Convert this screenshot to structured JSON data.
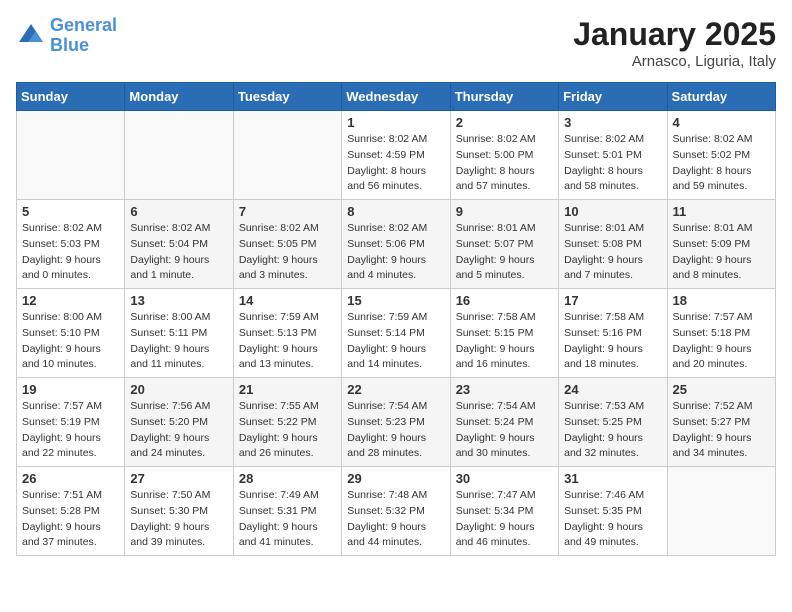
{
  "header": {
    "logo_line1": "General",
    "logo_line2": "Blue",
    "month": "January 2025",
    "location": "Arnasco, Liguria, Italy"
  },
  "days_of_week": [
    "Sunday",
    "Monday",
    "Tuesday",
    "Wednesday",
    "Thursday",
    "Friday",
    "Saturday"
  ],
  "weeks": [
    [
      {
        "day": "",
        "info": ""
      },
      {
        "day": "",
        "info": ""
      },
      {
        "day": "",
        "info": ""
      },
      {
        "day": "1",
        "info": "Sunrise: 8:02 AM\nSunset: 4:59 PM\nDaylight: 8 hours\nand 56 minutes."
      },
      {
        "day": "2",
        "info": "Sunrise: 8:02 AM\nSunset: 5:00 PM\nDaylight: 8 hours\nand 57 minutes."
      },
      {
        "day": "3",
        "info": "Sunrise: 8:02 AM\nSunset: 5:01 PM\nDaylight: 8 hours\nand 58 minutes."
      },
      {
        "day": "4",
        "info": "Sunrise: 8:02 AM\nSunset: 5:02 PM\nDaylight: 8 hours\nand 59 minutes."
      }
    ],
    [
      {
        "day": "5",
        "info": "Sunrise: 8:02 AM\nSunset: 5:03 PM\nDaylight: 9 hours\nand 0 minutes."
      },
      {
        "day": "6",
        "info": "Sunrise: 8:02 AM\nSunset: 5:04 PM\nDaylight: 9 hours\nand 1 minute."
      },
      {
        "day": "7",
        "info": "Sunrise: 8:02 AM\nSunset: 5:05 PM\nDaylight: 9 hours\nand 3 minutes."
      },
      {
        "day": "8",
        "info": "Sunrise: 8:02 AM\nSunset: 5:06 PM\nDaylight: 9 hours\nand 4 minutes."
      },
      {
        "day": "9",
        "info": "Sunrise: 8:01 AM\nSunset: 5:07 PM\nDaylight: 9 hours\nand 5 minutes."
      },
      {
        "day": "10",
        "info": "Sunrise: 8:01 AM\nSunset: 5:08 PM\nDaylight: 9 hours\nand 7 minutes."
      },
      {
        "day": "11",
        "info": "Sunrise: 8:01 AM\nSunset: 5:09 PM\nDaylight: 9 hours\nand 8 minutes."
      }
    ],
    [
      {
        "day": "12",
        "info": "Sunrise: 8:00 AM\nSunset: 5:10 PM\nDaylight: 9 hours\nand 10 minutes."
      },
      {
        "day": "13",
        "info": "Sunrise: 8:00 AM\nSunset: 5:11 PM\nDaylight: 9 hours\nand 11 minutes."
      },
      {
        "day": "14",
        "info": "Sunrise: 7:59 AM\nSunset: 5:13 PM\nDaylight: 9 hours\nand 13 minutes."
      },
      {
        "day": "15",
        "info": "Sunrise: 7:59 AM\nSunset: 5:14 PM\nDaylight: 9 hours\nand 14 minutes."
      },
      {
        "day": "16",
        "info": "Sunrise: 7:58 AM\nSunset: 5:15 PM\nDaylight: 9 hours\nand 16 minutes."
      },
      {
        "day": "17",
        "info": "Sunrise: 7:58 AM\nSunset: 5:16 PM\nDaylight: 9 hours\nand 18 minutes."
      },
      {
        "day": "18",
        "info": "Sunrise: 7:57 AM\nSunset: 5:18 PM\nDaylight: 9 hours\nand 20 minutes."
      }
    ],
    [
      {
        "day": "19",
        "info": "Sunrise: 7:57 AM\nSunset: 5:19 PM\nDaylight: 9 hours\nand 22 minutes."
      },
      {
        "day": "20",
        "info": "Sunrise: 7:56 AM\nSunset: 5:20 PM\nDaylight: 9 hours\nand 24 minutes."
      },
      {
        "day": "21",
        "info": "Sunrise: 7:55 AM\nSunset: 5:22 PM\nDaylight: 9 hours\nand 26 minutes."
      },
      {
        "day": "22",
        "info": "Sunrise: 7:54 AM\nSunset: 5:23 PM\nDaylight: 9 hours\nand 28 minutes."
      },
      {
        "day": "23",
        "info": "Sunrise: 7:54 AM\nSunset: 5:24 PM\nDaylight: 9 hours\nand 30 minutes."
      },
      {
        "day": "24",
        "info": "Sunrise: 7:53 AM\nSunset: 5:25 PM\nDaylight: 9 hours\nand 32 minutes."
      },
      {
        "day": "25",
        "info": "Sunrise: 7:52 AM\nSunset: 5:27 PM\nDaylight: 9 hours\nand 34 minutes."
      }
    ],
    [
      {
        "day": "26",
        "info": "Sunrise: 7:51 AM\nSunset: 5:28 PM\nDaylight: 9 hours\nand 37 minutes."
      },
      {
        "day": "27",
        "info": "Sunrise: 7:50 AM\nSunset: 5:30 PM\nDaylight: 9 hours\nand 39 minutes."
      },
      {
        "day": "28",
        "info": "Sunrise: 7:49 AM\nSunset: 5:31 PM\nDaylight: 9 hours\nand 41 minutes."
      },
      {
        "day": "29",
        "info": "Sunrise: 7:48 AM\nSunset: 5:32 PM\nDaylight: 9 hours\nand 44 minutes."
      },
      {
        "day": "30",
        "info": "Sunrise: 7:47 AM\nSunset: 5:34 PM\nDaylight: 9 hours\nand 46 minutes."
      },
      {
        "day": "31",
        "info": "Sunrise: 7:46 AM\nSunset: 5:35 PM\nDaylight: 9 hours\nand 49 minutes."
      },
      {
        "day": "",
        "info": ""
      }
    ]
  ]
}
